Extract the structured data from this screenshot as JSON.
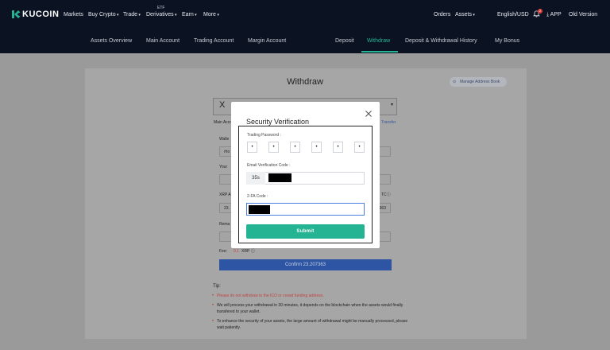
{
  "header": {
    "brand": "KUCOIN",
    "nav": [
      {
        "label": "Markets"
      },
      {
        "label": "Buy Crypto"
      },
      {
        "label": "Trade"
      },
      {
        "label": "Derivatives",
        "tag": "ETF"
      },
      {
        "label": "Earn"
      },
      {
        "label": "More"
      }
    ],
    "right": {
      "orders": "Orders",
      "assets": "Assets",
      "language": "English/USD",
      "notification_count": "2",
      "app": "APP",
      "old_version": "Old Version"
    }
  },
  "subnav": {
    "left": [
      "Assets Overview",
      "Main Account",
      "Trading Account",
      "Margin Account"
    ],
    "right": [
      "Deposit",
      "Withdraw",
      "Deposit & Withdrawal History",
      "My Bonus"
    ],
    "active": "Withdraw"
  },
  "background": {
    "title": "Withdraw",
    "manage_address": "Manage Address Book",
    "coin_symbol": "X",
    "main_account_label": "Main Acco",
    "transfer_link": "Transfer",
    "wallet_label": "Walle",
    "wallet_value": "rho",
    "your_label": "Your",
    "xrp_label": "XRP A",
    "xrp_right_label": "TC",
    "amount_value": "23.",
    "amount_right": "363",
    "remark_label": "Rema",
    "fee_label": "Fee:",
    "fee_value": "0.1",
    "fee_unit": "XRP",
    "confirm_button": "Confirm 23.207363",
    "tips_title": "Tip:",
    "tips": [
      "Please do not withdraw to the ICO or crowd funding address.",
      "We will process your withdrawal in 30 minutes, it depends on the blockchain when the assets would finally transfered to your wallet.",
      "To enhance the security of your assets, the large amount of withdrawal might be manually processed, please wait patiently."
    ]
  },
  "modal": {
    "title": "Security Verification",
    "trading_password_label": "Trading Password :",
    "password_digits": [
      "•",
      "•",
      "•",
      "•",
      "•",
      "•"
    ],
    "email_code_label": "Email Verification Code :",
    "countdown": "35s",
    "twofa_label": "2-FA Code :",
    "submit": "Submit"
  },
  "colors": {
    "nav_bg": "#0b1322",
    "accent_green": "#24b393",
    "confirm_blue": "#2d55a3",
    "tip_red": "#c04444"
  }
}
